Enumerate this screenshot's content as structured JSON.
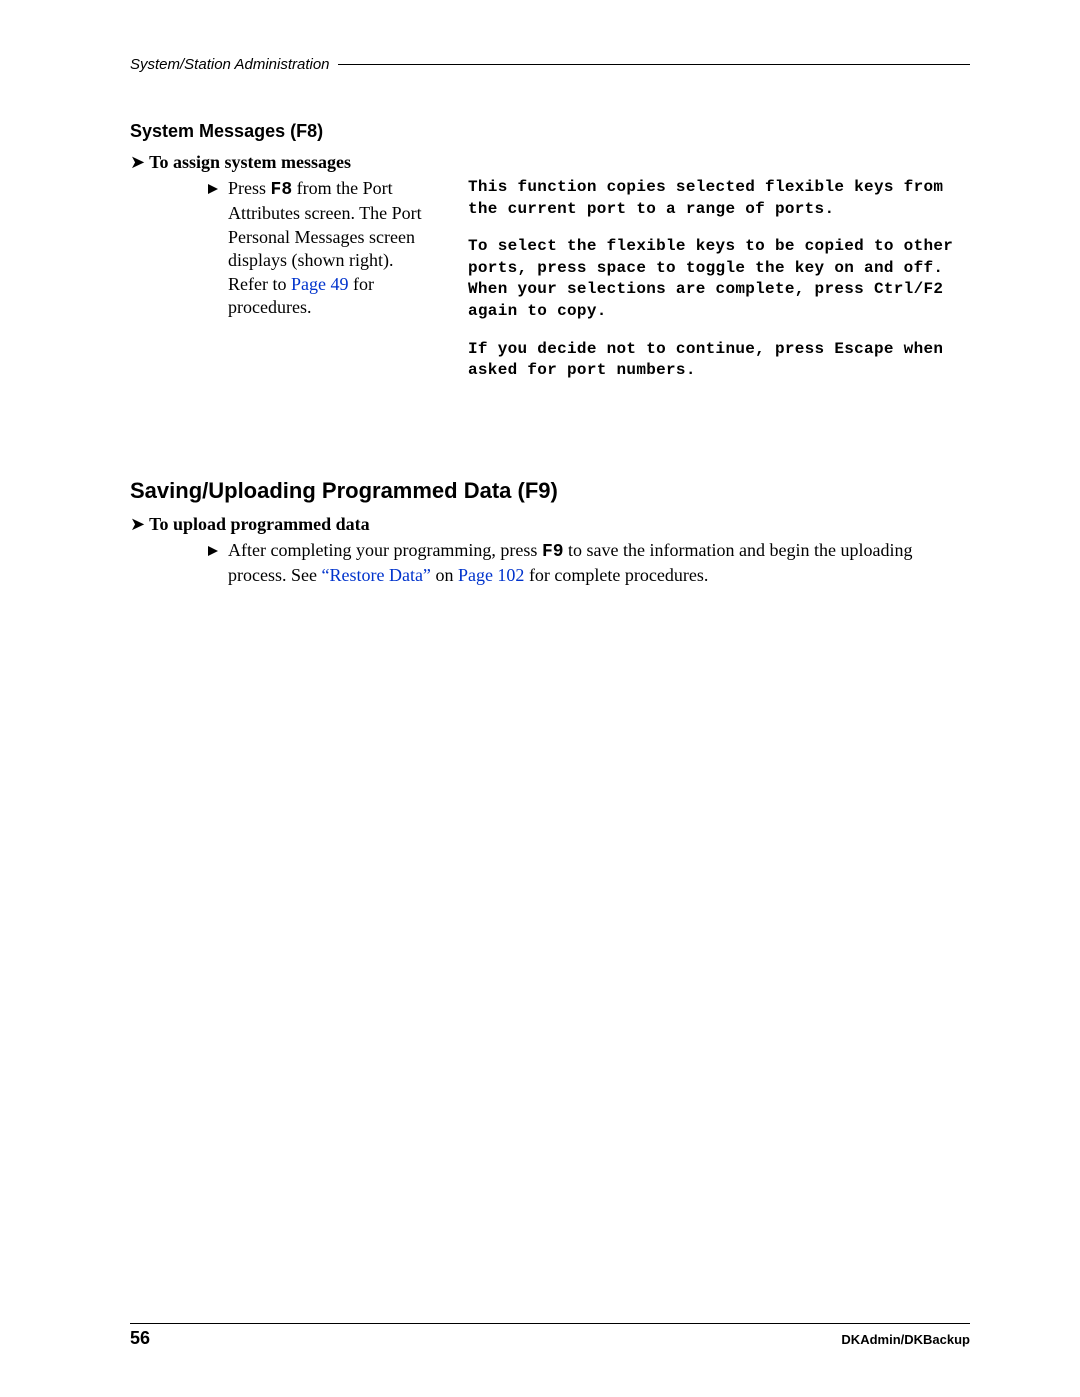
{
  "header": {
    "breadcrumb": "System/Station Administration"
  },
  "section1": {
    "heading": "System Messages (F8)",
    "sub_heading": "To assign system messages",
    "step": {
      "prefix": "Press ",
      "key": "F8",
      "mid1": " from the Port Attributes screen. The Port Personal Messages screen displays (shown right). Refer to ",
      "link": "Page 49",
      "suffix": " for procedures."
    },
    "screen": {
      "p1": "This function copies selected flexible keys from the current port to a range of ports.",
      "p2": "To select the flexible keys to be copied to other ports, press space to toggle the key on and off. When your selections are complete, press Ctrl/F2 again to copy.",
      "p3": "If you decide not to continue, press Escape when asked for port numbers."
    }
  },
  "section2": {
    "heading": "Saving/Uploading Programmed Data (F9)",
    "sub_heading": "To upload programmed data",
    "step": {
      "prefix": "After completing your programming, press ",
      "key": "F9",
      "mid1": " to save the information and begin the uploading process. See ",
      "link1": "“Restore Data”",
      "mid2": " on ",
      "link2": "Page 102",
      "suffix": " for complete procedures."
    }
  },
  "footer": {
    "page_number": "56",
    "doc_title": "DKAdmin/DKBackup"
  }
}
